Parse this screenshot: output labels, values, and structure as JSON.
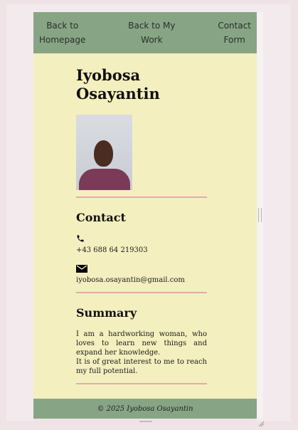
{
  "nav": {
    "items": [
      {
        "line1": "Back to",
        "line2": "Homepage"
      },
      {
        "line1": "Back to My",
        "line2": "Work"
      },
      {
        "line1": "Contact",
        "line2": "Form"
      }
    ]
  },
  "profile": {
    "name_line1": "Iyobosa",
    "name_line2": "Osayantin"
  },
  "contact": {
    "title": "Contact",
    "phone": "+43 688 64 219303",
    "email": "iyobosa.osayantin@gmail.com",
    "phone_icon": "phone-icon",
    "email_icon": "envelope-icon"
  },
  "summary": {
    "title": "Summary",
    "line1": "I am a hardworking woman, who loves to learn new things and expand her knowledge.",
    "line2": "It is of great interest to me to reach my full potential."
  },
  "footer": {
    "text": "© 2025 Iyobosa Osayantin"
  },
  "colors": {
    "nav_bg": "#87a585",
    "page_bg": "#f4efbe",
    "divider": "#e6a9a8"
  }
}
